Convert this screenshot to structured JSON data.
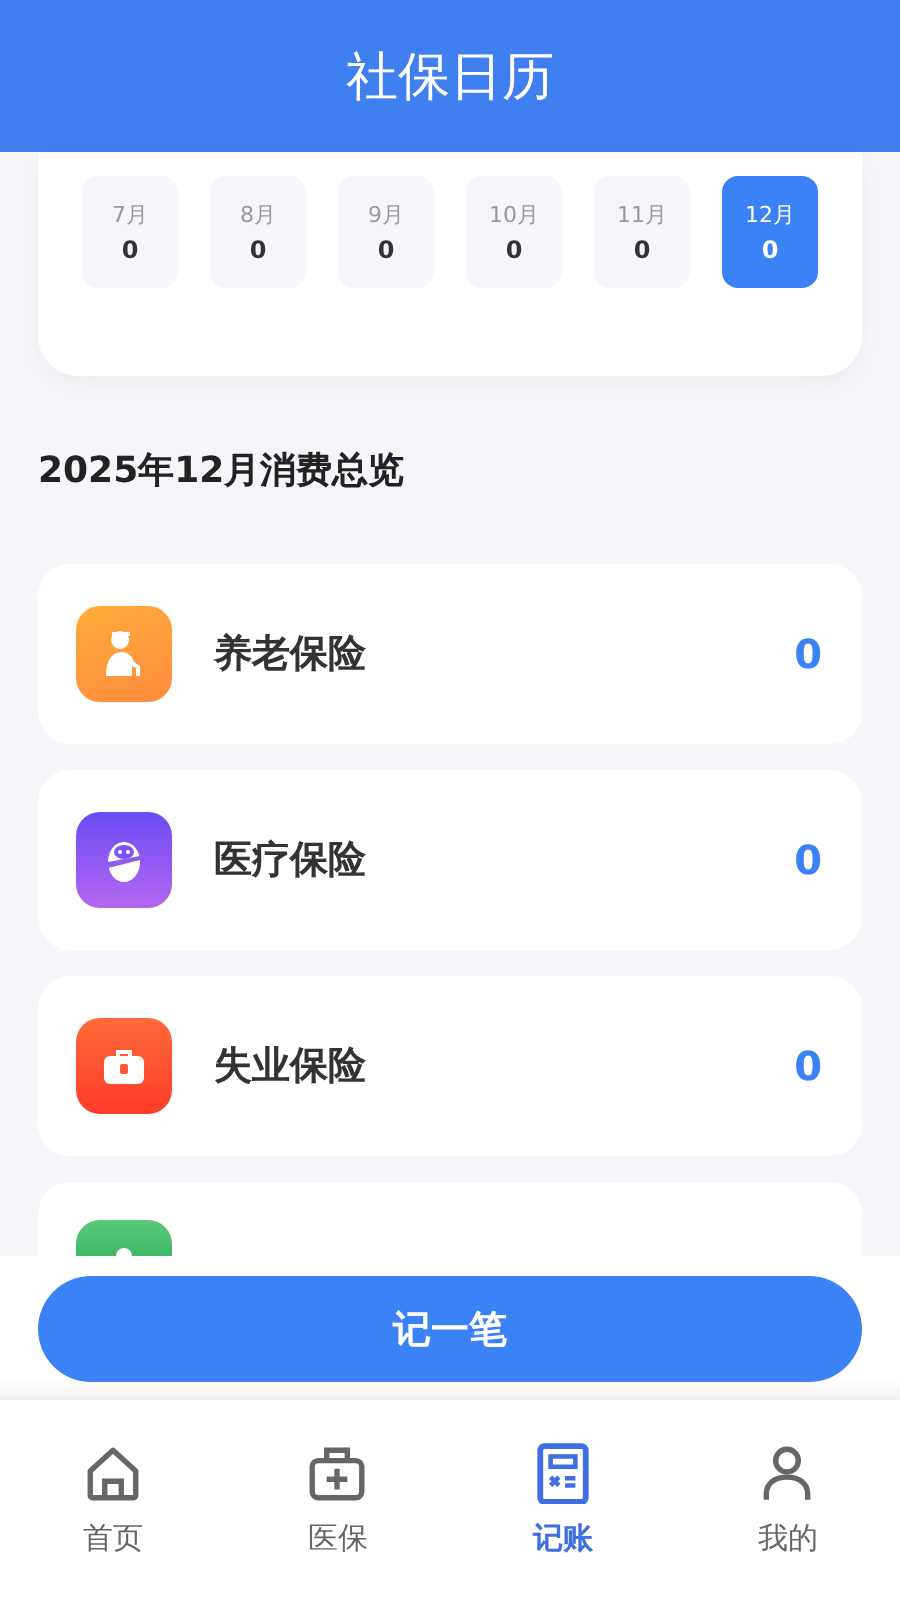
{
  "header": {
    "title": "社保日历"
  },
  "months": [
    {
      "label": "7月",
      "amount": "0",
      "selected": false
    },
    {
      "label": "8月",
      "amount": "0",
      "selected": false
    },
    {
      "label": "9月",
      "amount": "0",
      "selected": false
    },
    {
      "label": "10月",
      "amount": "0",
      "selected": false
    },
    {
      "label": "11月",
      "amount": "0",
      "selected": false
    },
    {
      "label": "12月",
      "amount": "0",
      "selected": true
    }
  ],
  "summary_title": "2025年12月消费总览",
  "insurances": [
    {
      "kind": "pension",
      "name": "养老保险",
      "amount": "0"
    },
    {
      "kind": "medical",
      "name": "医疗保险",
      "amount": "0"
    },
    {
      "kind": "unemployment",
      "name": "失业保险",
      "amount": "0"
    },
    {
      "kind": "injury"
    }
  ],
  "record_button": "记一笔",
  "tabs": [
    {
      "kind": "home",
      "label": "首页",
      "selected": false
    },
    {
      "kind": "medical",
      "label": "医保",
      "selected": false
    },
    {
      "kind": "ledger",
      "label": "记账",
      "selected": true
    },
    {
      "kind": "profile",
      "label": "我的",
      "selected": false
    }
  ]
}
